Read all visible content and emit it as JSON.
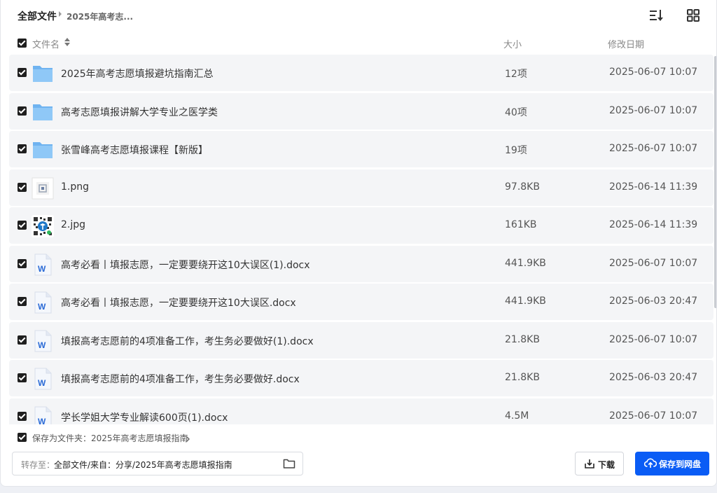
{
  "breadcrumb": {
    "root": "全部文件",
    "current": "2025年高考志..."
  },
  "toolbar": {
    "sort_icon": "sort-icon",
    "grid_icon": "grid-view-icon"
  },
  "columns": {
    "name": "文件名",
    "size": "大小",
    "date": "修改日期"
  },
  "files": [
    {
      "name": "2025年高考志愿填报避坑指南汇总",
      "size": "12项",
      "date": "2025-06-07 10:07",
      "icon": "folder-icon"
    },
    {
      "name": "高考志愿填报讲解大学专业之医学类",
      "size": "40项",
      "date": "2025-06-07 10:07",
      "icon": "folder-icon"
    },
    {
      "name": "张雪峰高考志愿填报课程【新版】",
      "size": "19项",
      "date": "2025-06-07 10:07",
      "icon": "folder-icon"
    },
    {
      "name": "1.png",
      "size": "97.8KB",
      "date": "2025-06-14 11:39",
      "icon": "image-thumbnail-icon"
    },
    {
      "name": "2.jpg",
      "size": "161KB",
      "date": "2025-06-14 11:39",
      "icon": "qr-code-thumbnail-icon"
    },
    {
      "name": "高考必看丨填报志愿，一定要要绕开这10大误区(1).docx",
      "size": "441.9KB",
      "date": "2025-06-07 10:07",
      "icon": "word-doc-icon"
    },
    {
      "name": "高考必看丨填报志愿，一定要要绕开这10大误区.docx",
      "size": "441.9KB",
      "date": "2025-06-03 20:47",
      "icon": "word-doc-icon"
    },
    {
      "name": "填报高考志愿前的4项准备工作，考生务必要做好(1).docx",
      "size": "21.8KB",
      "date": "2025-06-07 10:07",
      "icon": "word-doc-icon"
    },
    {
      "name": "填报高考志愿前的4项准备工作，考生务必要做好.docx",
      "size": "21.8KB",
      "date": "2025-06-03 20:47",
      "icon": "word-doc-icon"
    },
    {
      "name": "学长学姐大学专业解读600页(1).docx",
      "size": "4.5M",
      "date": "2025-06-07 10:07",
      "icon": "word-doc-icon"
    }
  ],
  "footer": {
    "save_as_folder": "保存为文件夹：2025年高考志愿填报指南",
    "path_label": "转存至：",
    "path_value": "全部文件/来自：分享/2025年高考志愿填报指南",
    "download_label": "下载",
    "save_label": "保存到网盘"
  },
  "colors": {
    "accent": "#0a5cf5",
    "row_bg": "#f4f5f7",
    "folder": "#7dbdf5",
    "word": "#2b6bd6"
  }
}
